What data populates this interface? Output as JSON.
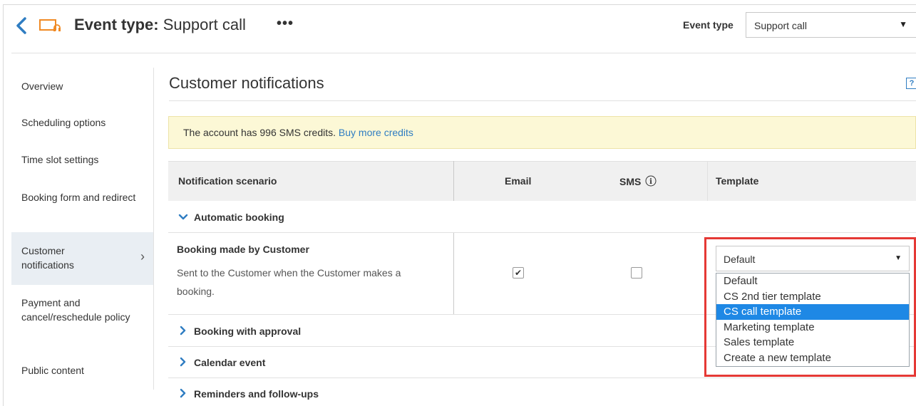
{
  "header": {
    "title_prefix": "Event type:",
    "title_value": "Support call",
    "more": "•••",
    "event_type_label": "Event type",
    "event_type_value": "Support call"
  },
  "sidebar": {
    "items": [
      {
        "label": "Overview"
      },
      {
        "label": "Scheduling options"
      },
      {
        "label": "Time slot settings"
      },
      {
        "label": "Booking form and redirect"
      },
      {
        "label": "Customer notifications"
      },
      {
        "label": "Payment and cancel/reschedule policy"
      },
      {
        "label": "Public content"
      }
    ]
  },
  "main": {
    "title": "Customer notifications",
    "help": "?",
    "notice_text": "The account has 996 SMS credits.",
    "notice_link": "Buy more credits"
  },
  "table": {
    "headers": {
      "scenario": "Notification scenario",
      "email": "Email",
      "sms": "SMS",
      "template": "Template"
    },
    "groups": [
      {
        "label": "Automatic booking",
        "expanded": true
      },
      {
        "label": "Booking with approval",
        "expanded": false
      },
      {
        "label": "Calendar event",
        "expanded": false
      },
      {
        "label": "Reminders and follow-ups",
        "expanded": false
      }
    ],
    "row": {
      "name": "Booking made by Customer",
      "description": "Sent to the Customer when the Customer makes a booking.",
      "email_checked": true,
      "sms_checked": false,
      "template_value": "Default"
    }
  },
  "template_dropdown": {
    "options": [
      "Default",
      "CS 2nd tier template",
      "CS call template",
      "Marketing template",
      "Sales template",
      "Create a new template"
    ],
    "highlighted": "CS call template"
  },
  "colors": {
    "accent": "#2f7dc2",
    "highlight_border": "#e53935",
    "selected_option": "#1e88e5",
    "notice_bg": "#fcf8d6"
  }
}
